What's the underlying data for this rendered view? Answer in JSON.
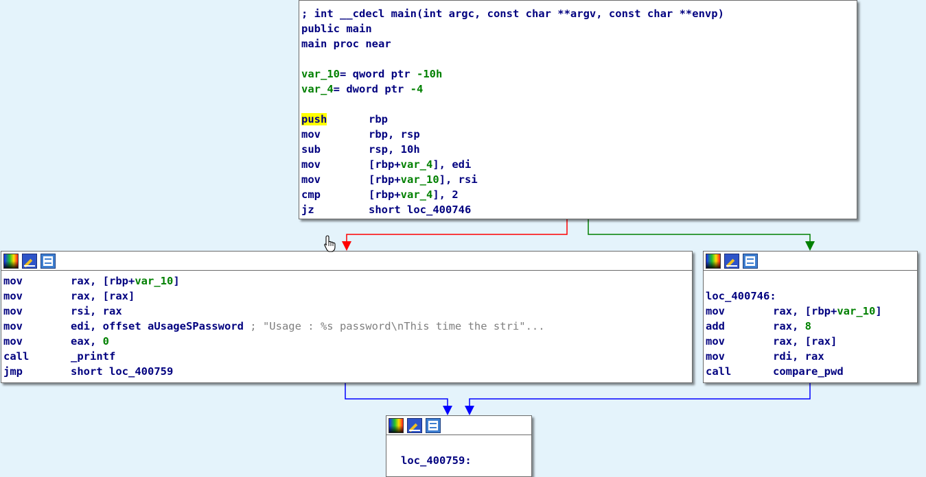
{
  "main_block": {
    "header_lines": [
      "; int __cdecl main(int argc, const char **argv, const char **envp)",
      "public main",
      "main proc near"
    ],
    "vars": [
      {
        "name": "var_10",
        "eq": "= qword ptr ",
        "value": "-10h"
      },
      {
        "name": "var_4",
        "eq": "= dword ptr ",
        "value": "-4"
      }
    ],
    "instructions": [
      {
        "mn": "push",
        "op": "rbp"
      },
      {
        "mn": "mov",
        "op": "rbp, rsp"
      },
      {
        "mn": "sub",
        "op": "rsp, 10h"
      },
      {
        "mn": "mov",
        "op1": "[rbp+",
        "var": "var_4",
        "op2": "], edi"
      },
      {
        "mn": "mov",
        "op1": "[rbp+",
        "var": "var_10",
        "op2": "], rsi"
      },
      {
        "mn": "cmp",
        "op1": "[rbp+",
        "var": "var_4",
        "op2": "], 2"
      },
      {
        "mn": "jz",
        "op": "short loc_400746"
      }
    ]
  },
  "left_block": {
    "instructions": [
      {
        "mn": "mov",
        "op1": "rax, [rbp+",
        "var": "var_10",
        "op2": "]"
      },
      {
        "mn": "mov",
        "op": "rax, [rax]"
      },
      {
        "mn": "mov",
        "op": "rsi, rax"
      },
      {
        "mn": "mov",
        "op": "edi, offset aUsageSPassword",
        "comment": " ; \"Usage : %s password\\nThis time the stri\"..."
      },
      {
        "mn": "mov",
        "op": "eax, ",
        "num": "0"
      },
      {
        "mn": "call",
        "op": "_printf"
      },
      {
        "mn": "jmp",
        "op": "short loc_400759"
      }
    ]
  },
  "right_block": {
    "label": "loc_400746:",
    "instructions": [
      {
        "mn": "mov",
        "op1": "rax, [rbp+",
        "var": "var_10",
        "op2": "]"
      },
      {
        "mn": "add",
        "op": "rax, ",
        "num": "8"
      },
      {
        "mn": "mov",
        "op": "rax, [rax]"
      },
      {
        "mn": "mov",
        "op": "rdi, rax"
      },
      {
        "mn": "call",
        "op": "compare_pwd"
      }
    ]
  },
  "bottom_block": {
    "label": "loc_400759:"
  },
  "colors": {
    "background": "#e4f3fb",
    "mnemonic": "#00007f",
    "variable": "#008000",
    "comment": "#7f7f7f",
    "highlight": "#ffff00",
    "edge_false": "#ff0000",
    "edge_true": "#008000",
    "edge_uncond": "#0000ff"
  }
}
